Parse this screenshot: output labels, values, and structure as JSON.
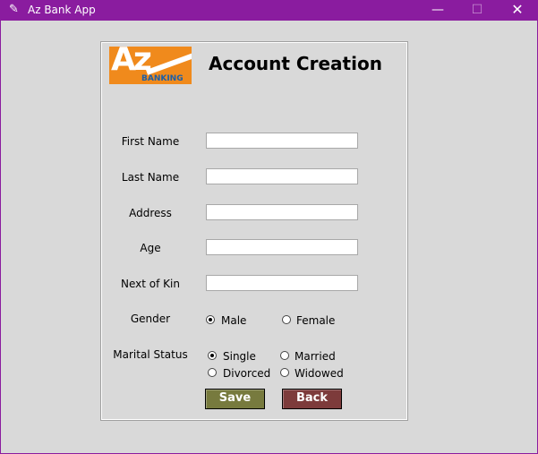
{
  "window": {
    "title": "Az Bank App",
    "title_icon": "feather-icon",
    "controls": {
      "minimize": "—",
      "maximize": "☐",
      "close": "✕"
    }
  },
  "logo": {
    "text_top": "Az",
    "text_bottom": "BANKING"
  },
  "form": {
    "heading": "Account Creation",
    "fields": {
      "first_name_label": "First Name",
      "last_name_label": "Last Name",
      "address_label": "Address",
      "age_label": "Age",
      "next_of_kin_label": "Next of Kin",
      "first_name": "",
      "last_name": "",
      "address": "",
      "age": "",
      "next_of_kin": ""
    },
    "gender": {
      "label": "Gender",
      "options": [
        "Male",
        "Female"
      ],
      "selected": "Male"
    },
    "marital_status": {
      "label": "Marital Status",
      "options": [
        "Single",
        "Married",
        "Divorced",
        "Widowed"
      ],
      "selected": "Single"
    },
    "buttons": {
      "save": "Save",
      "back": "Back"
    }
  },
  "colors": {
    "titlebar": "#8a1c9f",
    "background": "#d9d9d9",
    "save_button": "#777a3e",
    "back_button": "#7d3b3b",
    "logo_orange": "#f08a1c"
  }
}
